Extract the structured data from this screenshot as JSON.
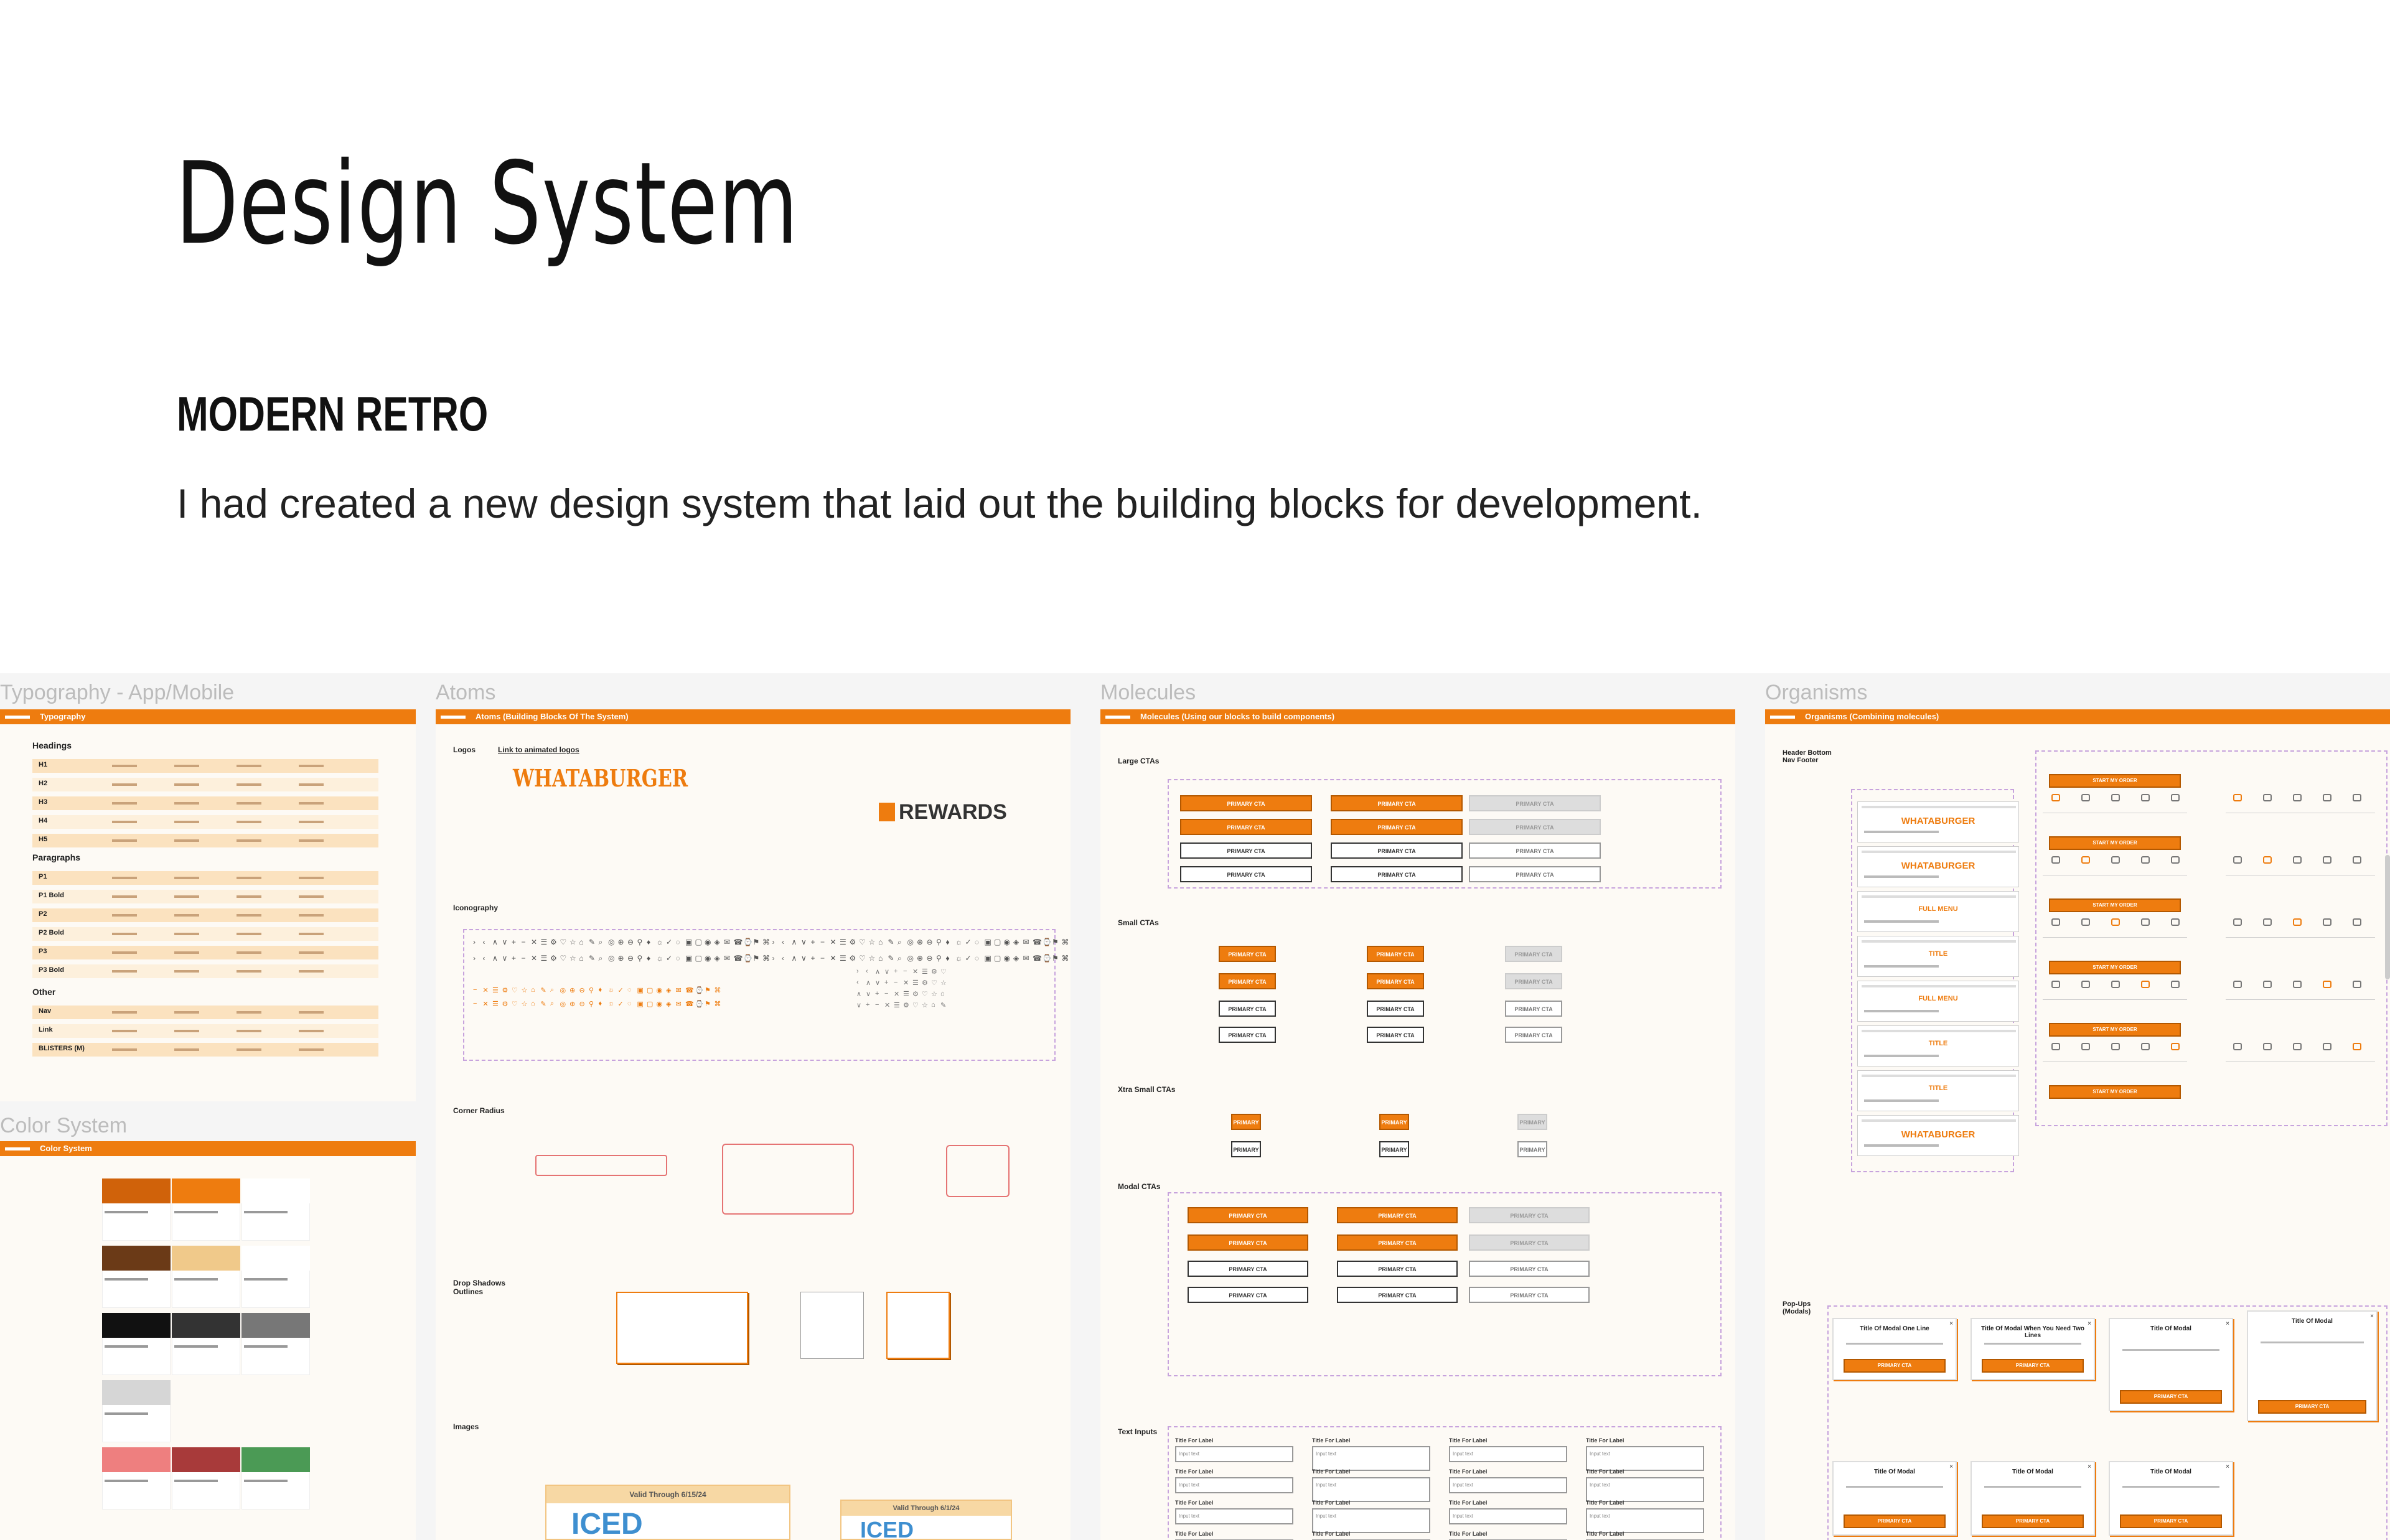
{
  "header": {
    "title": "Design System",
    "subtitle": "MODERN RETRO",
    "description": "I had created a new design system that laid out the building blocks for development."
  },
  "boards": {
    "typography": {
      "label": "Typography - App/Mobile",
      "bar": "Typography",
      "headings": "Headings",
      "paragraphs": "Paragraphs",
      "other": "Other",
      "styles_h": [
        "H1",
        "H2",
        "H3",
        "H4",
        "H5"
      ],
      "styles_p": [
        "P1",
        "P1 Bold",
        "P2",
        "P2 Bold",
        "P3",
        "P3 Bold"
      ],
      "styles_o": [
        "Nav",
        "Link",
        "BLISTERS (M)"
      ]
    },
    "color": {
      "label": "Color System",
      "bar": "Color System",
      "colors": [
        "#d0620a",
        "#ee7c0f",
        "#ffffff",
        "#6b3a17",
        "#f0c98a",
        "#ffffff",
        "#111111",
        "#333333",
        "#777777",
        "#d6d6d6",
        "#ee7f7f",
        "#a83a3a",
        "#4b9a55"
      ]
    },
    "atoms": {
      "label": "Atoms",
      "bar": "Atoms (Building Blocks Of The System)",
      "logos": "Logos",
      "link": "Link to animated logos",
      "brand": "WHATABURGER",
      "rewards": "REWARDS",
      "iconography": "Iconography",
      "corner": "Corner Radius",
      "shadows": "Drop Shadows Outlines",
      "images": "Images",
      "badge1": "Valid Through 6/15/24",
      "badge2": "Valid Through 6/1/24",
      "promo": "ICED"
    },
    "molecules": {
      "label": "Molecules",
      "bar": "Molecules (Using our blocks to build components)",
      "large": "Large CTAs",
      "small": "Small CTAs",
      "xtra": "Xtra Small CTAs",
      "modal": "Modal CTAs",
      "inputs": "Text Inputs",
      "cta": "PRIMARY CTA",
      "cta_x": "PRIMARY",
      "input_label": "Title For Label",
      "input_placeholder": "Input text"
    },
    "organisms": {
      "label": "Organisms",
      "bar": "Organisms (Combining molecules)",
      "hbf": "Header Bottom Nav Footer",
      "popups": "Pop-Ups (Modals)",
      "brand": "WHATABURGER",
      "menu": "FULL MENU",
      "title": "TITLE",
      "start": "START MY ORDER",
      "modal_titles": [
        "Title Of Modal One Line",
        "Title Of Modal When You Need Two Lines",
        "Title Of Modal",
        "Title Of Modal",
        "Title Of Modal",
        "Title Of Modal",
        "Title Of Modal"
      ],
      "modal_cta": "PRIMARY CTA"
    }
  }
}
